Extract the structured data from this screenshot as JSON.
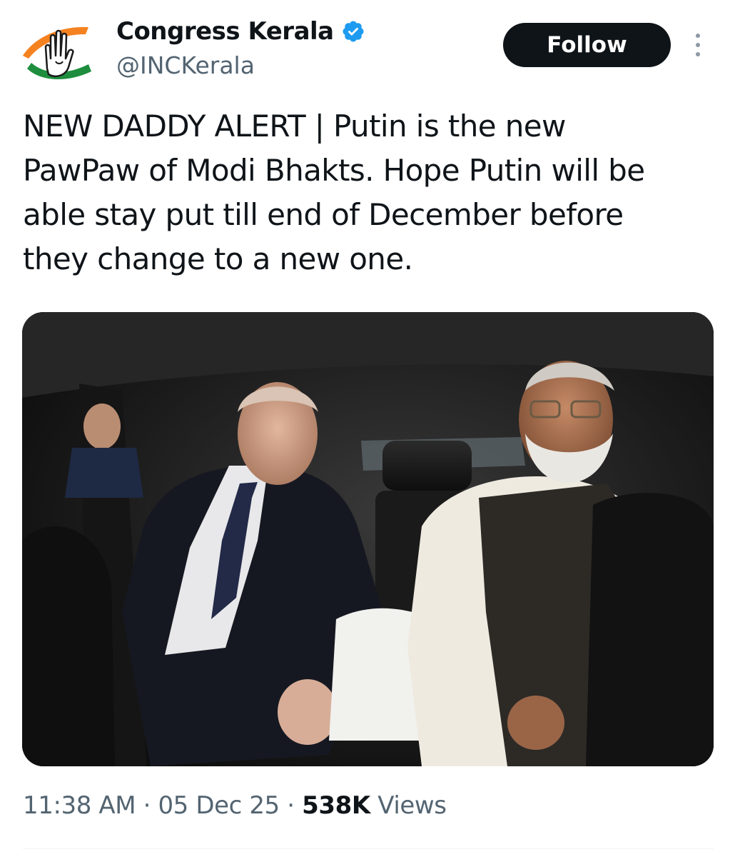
{
  "author": {
    "display_name": "Congress Kerala",
    "handle": "@INCKerala",
    "verified": true,
    "avatar_icon": "congress-hand-logo",
    "verified_icon": "verified-badge-icon",
    "verified_color": "#1d9bf0"
  },
  "actions": {
    "follow_label": "Follow",
    "more_icon": "more-vertical-icon"
  },
  "tweet": {
    "text": "NEW DADDY ALERT | Putin is the new\nPawPaw of Modi Bhakts. Hope Putin will be\nable stay put till end of December before\nthey change to a new one."
  },
  "meta": {
    "time": "11:38 AM",
    "separator": "·",
    "date": "05 Dec 25",
    "views_count": "538K",
    "views_label": "Views"
  },
  "colors": {
    "text_primary": "#0f1419",
    "text_secondary": "#536471",
    "follow_bg": "#0f1419",
    "follow_text": "#ffffff"
  }
}
